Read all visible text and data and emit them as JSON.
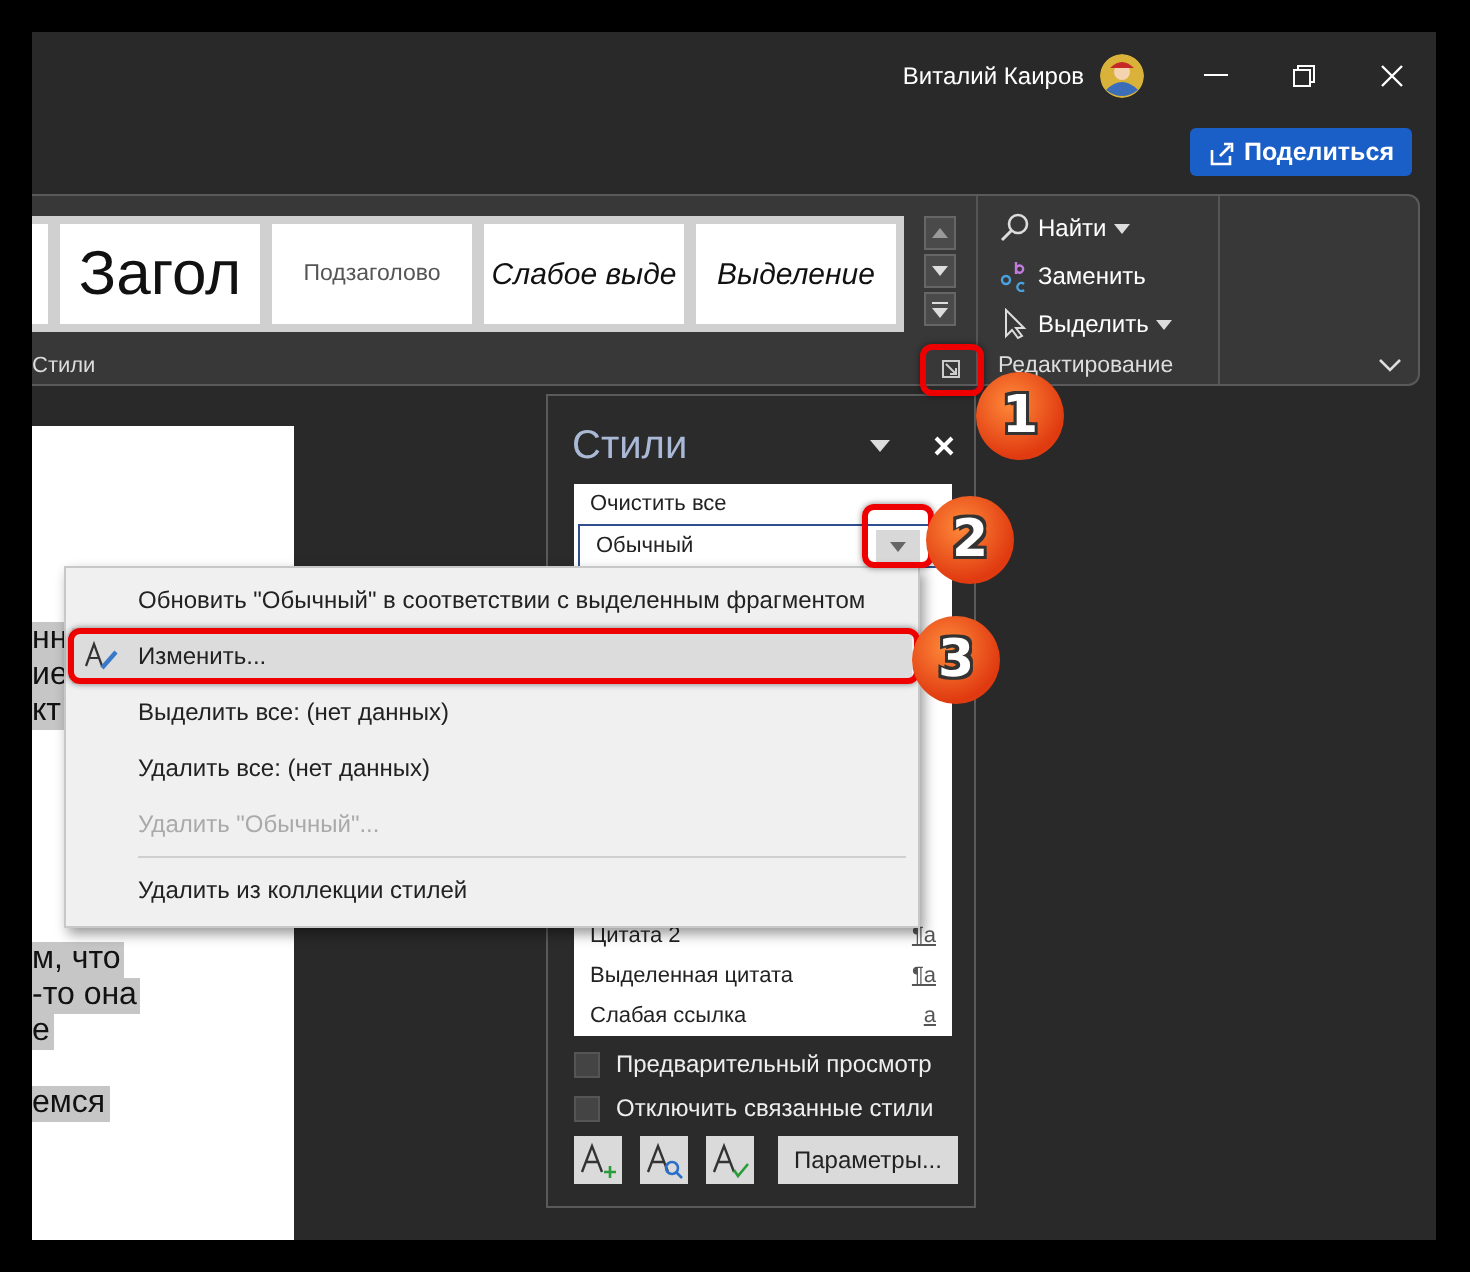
{
  "title_bar": {
    "user_name": "Виталий Каиров"
  },
  "share_button": {
    "label": "Поделиться"
  },
  "ribbon": {
    "style_gallery": [
      {
        "label": "Загол",
        "kind": "heading"
      },
      {
        "label": "Подзаголово",
        "kind": "subtitle"
      },
      {
        "label": "Слабое выде",
        "kind": "italic"
      },
      {
        "label": "Выделение",
        "kind": "italic"
      }
    ],
    "styles_group_label": "Стили",
    "editing_commands": [
      {
        "label": "Найти",
        "kind": "find",
        "has_menu": true
      },
      {
        "label": "Заменить",
        "kind": "replace",
        "has_menu": false
      },
      {
        "label": "Выделить",
        "kind": "select",
        "has_menu": true
      }
    ],
    "editing_group_label": "Редактирование"
  },
  "document": {
    "paragraphs": [
      [
        "нн",
        "ие",
        "кт"
      ],
      [
        "м, что",
        "-то она",
        "е"
      ],
      [
        "емся"
      ]
    ]
  },
  "styles_pane": {
    "title": "Стили",
    "top_items": [
      {
        "label": "Очистить все",
        "selected": false
      },
      {
        "label": "Обычный",
        "selected": true
      }
    ],
    "bottom_items": [
      {
        "label": "Цитата 2",
        "marker": "¶a"
      },
      {
        "label": "Выделенная цитата",
        "marker": "¶a"
      },
      {
        "label": "Слабая ссылка",
        "marker": "a"
      }
    ],
    "options": [
      {
        "label": "Предварительный просмотр",
        "checked": false
      },
      {
        "label": "Отключить связанные стили",
        "checked": false
      }
    ],
    "parameters_button": "Параметры..."
  },
  "context_menu": [
    {
      "kind": "command",
      "label": "Обновить \"Обычный\" в соответствии с выделенным фрагментом",
      "selected": false,
      "disabled": false
    },
    {
      "kind": "command_with_icon",
      "label": "Изменить...",
      "selected": true,
      "disabled": false
    },
    {
      "kind": "command",
      "label": "Выделить все: (нет данных)",
      "selected": false,
      "disabled": false
    },
    {
      "kind": "command",
      "label": "Удалить все: (нет данных)",
      "selected": false,
      "disabled": false
    },
    {
      "kind": "command",
      "label": "Удалить \"Обычный\"...",
      "selected": false,
      "disabled": true
    },
    {
      "kind": "separator"
    },
    {
      "kind": "command",
      "label": "Удалить из коллекции стилей",
      "selected": false,
      "disabled": false
    }
  ],
  "callouts": [
    {
      "number": "1"
    },
    {
      "number": "2"
    },
    {
      "number": "3"
    }
  ]
}
